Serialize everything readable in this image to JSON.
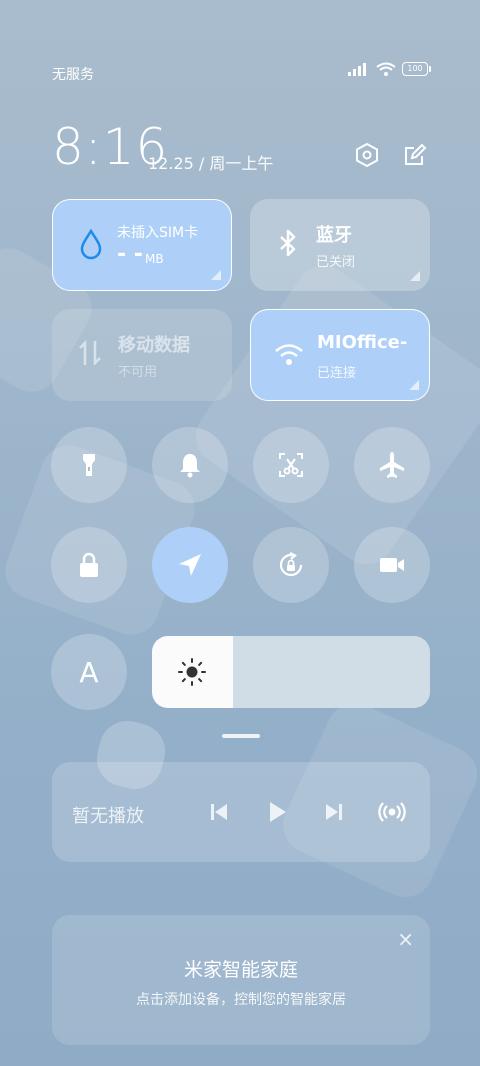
{
  "status_bar": {
    "carrier": "无服务",
    "battery": "100"
  },
  "header": {
    "time": "8:16",
    "date": "12.25 / 周一上午"
  },
  "tiles": {
    "data_usage": {
      "title": "未插入SIM卡",
      "value": "- -",
      "unit": "MB"
    },
    "bluetooth": {
      "title": "蓝牙",
      "status": "已关闭"
    },
    "mobile_data": {
      "title": "移动数据",
      "status": "不可用"
    },
    "wifi": {
      "title": "MIOffice-",
      "status": "已连接"
    }
  },
  "brightness": {
    "level": 0.29
  },
  "font_button": {
    "label": "A"
  },
  "media": {
    "title": "暂无播放"
  },
  "smart_home": {
    "title": "米家智能家庭",
    "subtitle": "点击添加设备，控制您的智能家居",
    "close": "×"
  },
  "colors": {
    "accent": "#aed0f8",
    "panel": "#9fb6cb"
  }
}
